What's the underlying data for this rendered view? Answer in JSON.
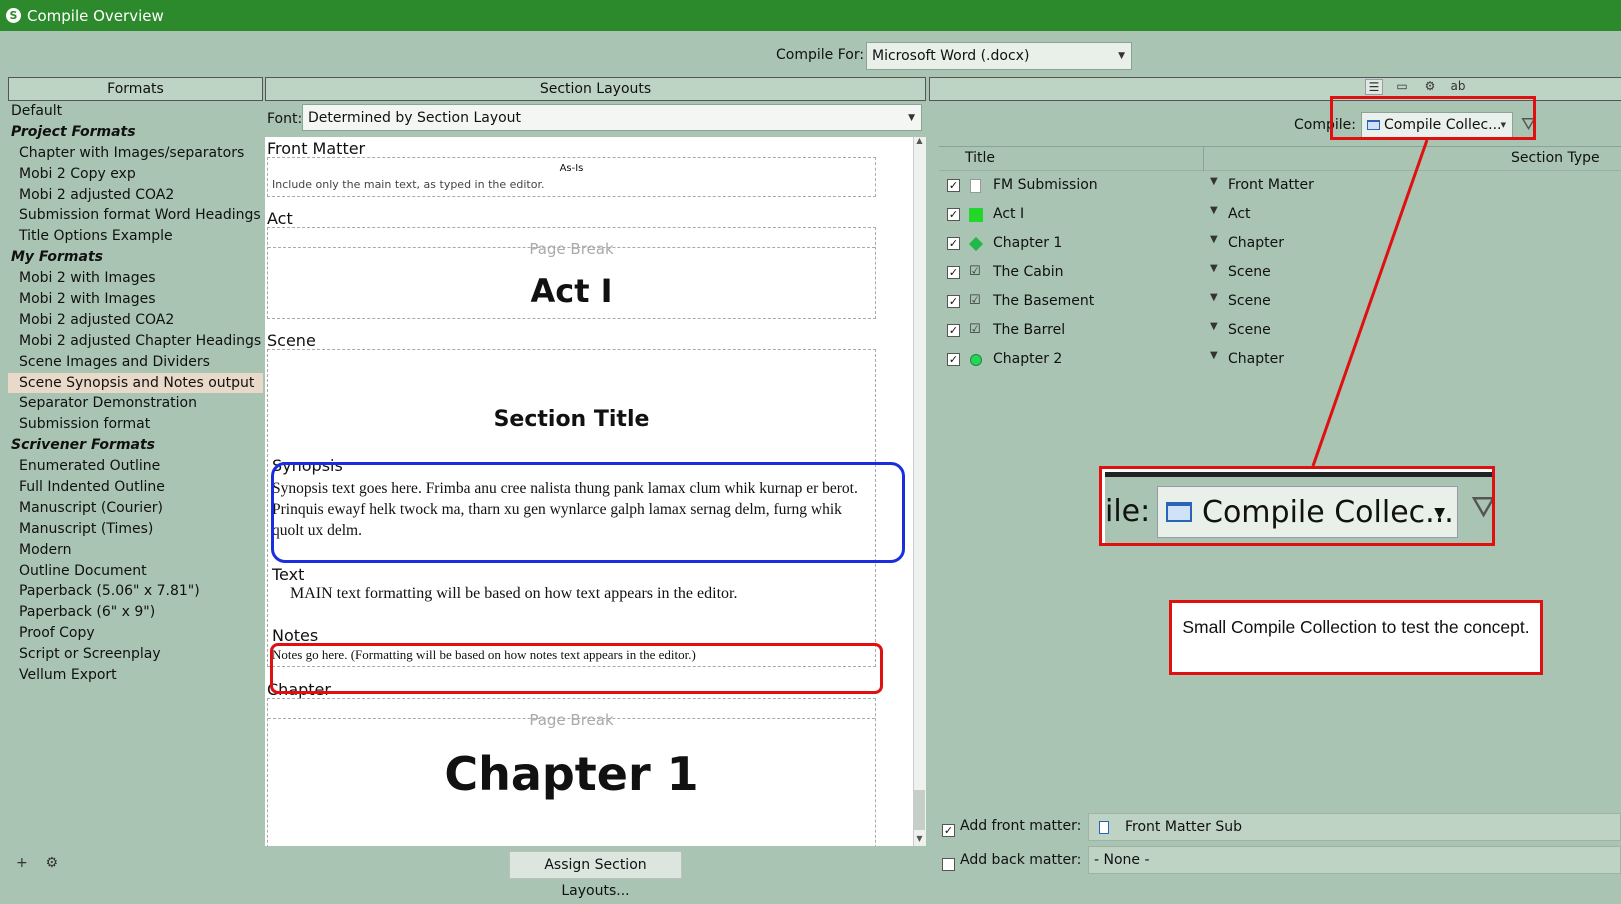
{
  "window": {
    "title": "Compile Overview"
  },
  "compile_for": {
    "label": "Compile For:",
    "value": "Microsoft Word (.docx)"
  },
  "formats": {
    "header": "Formats",
    "items": [
      {
        "label": "Default",
        "kind": "plain"
      },
      {
        "label": "Project Formats",
        "kind": "group"
      },
      {
        "label": "Chapter with Images/separators",
        "kind": "item"
      },
      {
        "label": "Mobi 2 Copy exp",
        "kind": "item"
      },
      {
        "label": "Mobi 2 adjusted COA2",
        "kind": "item"
      },
      {
        "label": "Submission format Word Headings",
        "kind": "item"
      },
      {
        "label": "Title Options Example",
        "kind": "item"
      },
      {
        "label": "My Formats",
        "kind": "group"
      },
      {
        "label": "Mobi 2  with Images",
        "kind": "item"
      },
      {
        "label": "Mobi 2  with Images",
        "kind": "item"
      },
      {
        "label": "Mobi 2 adjusted COA2",
        "kind": "item"
      },
      {
        "label": "Mobi 2 adjusted Chapter Headings",
        "kind": "item"
      },
      {
        "label": "Scene Images and Dividers",
        "kind": "item"
      },
      {
        "label": "Scene Synopsis and Notes output",
        "kind": "selected"
      },
      {
        "label": "Separator Demonstration",
        "kind": "item"
      },
      {
        "label": "Submission format",
        "kind": "item"
      },
      {
        "label": "Scrivener Formats",
        "kind": "group"
      },
      {
        "label": "Enumerated Outline",
        "kind": "item"
      },
      {
        "label": "Full Indented Outline",
        "kind": "item"
      },
      {
        "label": "Manuscript (Courier)",
        "kind": "item"
      },
      {
        "label": "Manuscript (Times)",
        "kind": "item"
      },
      {
        "label": "Modern",
        "kind": "item"
      },
      {
        "label": "Outline Document",
        "kind": "item"
      },
      {
        "label": "Paperback (5.06\" x 7.81\")",
        "kind": "item"
      },
      {
        "label": "Paperback (6\" x 9\")",
        "kind": "item"
      },
      {
        "label": "Proof Copy",
        "kind": "item"
      },
      {
        "label": "Script or Screenplay",
        "kind": "item"
      },
      {
        "label": "Vellum Export",
        "kind": "item"
      }
    ],
    "bottom_icons": [
      "add-icon",
      "gear-icon"
    ]
  },
  "section_layouts": {
    "header": "Section Layouts",
    "font_label": "Font:",
    "font_value": "Determined by Section Layout",
    "front_matter": {
      "label": "Front Matter",
      "as_is": "As-Is",
      "desc": "Include only the main text, as typed in the editor."
    },
    "act": {
      "label": "Act",
      "page_break": "Page Break",
      "title": "Act I"
    },
    "scene": {
      "label": "Scene",
      "title": "Section Title",
      "synopsis_label": "Synopsis",
      "synopsis_text": "Synopsis text goes here. Frimba anu cree nalista thung pank lamax clum whik kurnap er berot. Prinquis ewayf helk twock ma, tharn xu gen wynlarce galph lamax sernag delm, furng whik quolt ux delm.",
      "text_label": "Text",
      "text_body": "MAIN text formatting will be based on how text appears in the editor.",
      "notes_label": "Notes",
      "notes_text": "Notes go here. (Formatting will be based on how notes text appears in the editor.)"
    },
    "chapter": {
      "label": "Chapter",
      "page_break": "Page Break",
      "title": "Chapter 1"
    },
    "assign_button": "Assign Section Layouts..."
  },
  "contents": {
    "toolbar": [
      "list-icon",
      "tag-icon",
      "gear-icon",
      "replace-icon"
    ],
    "compile_label": "Compile:",
    "compile_value": "Compile Collec...",
    "col_title": "Title",
    "col_type": "Section Type",
    "rows": [
      {
        "title": "FM Submission",
        "type": "Front Matter",
        "icon": "document-icon",
        "checked": true
      },
      {
        "title": "Act I",
        "type": "Act",
        "icon": "green-square-icon",
        "checked": true
      },
      {
        "title": "Chapter 1",
        "type": "Chapter",
        "icon": "green-diamond-icon",
        "checked": true
      },
      {
        "title": "The Cabin",
        "type": "Scene",
        "icon": "checkmark-icon",
        "checked": true
      },
      {
        "title": "The Basement",
        "type": "Scene",
        "icon": "checkmark-icon",
        "checked": true
      },
      {
        "title": "The Barrel",
        "type": "Scene",
        "icon": "checkmark-icon",
        "checked": true
      },
      {
        "title": "Chapter 2",
        "type": "Chapter",
        "icon": "green-circle-icon",
        "checked": true
      }
    ],
    "front_matter": {
      "label": "Add front matter:",
      "value": "Front Matter Sub",
      "checked": true
    },
    "back_matter": {
      "label": "Add back matter:",
      "value": "- None -",
      "checked": false
    }
  },
  "annotation": {
    "zoom_label": "ile:",
    "zoom_value": "Compile Collec...",
    "callout": "Small Compile Collection to test the concept.",
    "color": "#e01010",
    "synopsis_box_color": "#1a2ee0"
  }
}
